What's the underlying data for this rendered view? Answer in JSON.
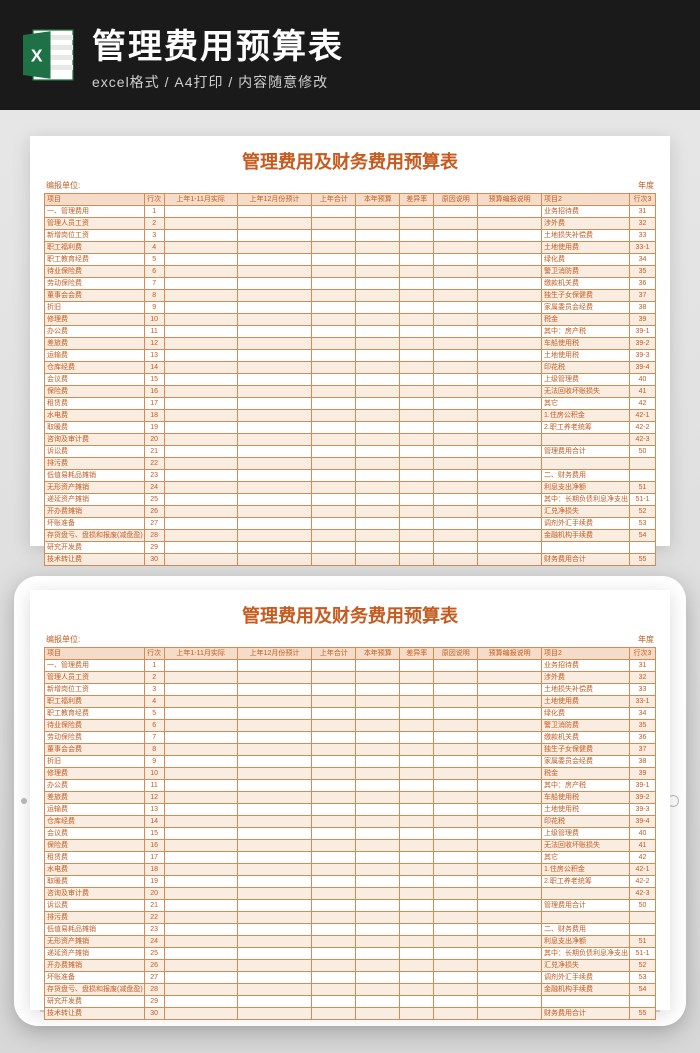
{
  "header": {
    "title": "管理费用预算表",
    "subtitle": "excel格式 / A4打印 / 内容随意修改"
  },
  "sheet": {
    "title": "管理费用及财务费用预算表",
    "unit_label": "编报单位:",
    "year_label": "年度",
    "columns": [
      "项目",
      "行次",
      "上年1-11月实际",
      "上年12月份预计",
      "上年合计",
      "本年预算",
      "差异率",
      "原因说明",
      "预算编报说明",
      "项目2",
      "行次3"
    ],
    "rows": [
      {
        "a": "一、管理费用",
        "n": "1",
        "b": "业务招待费",
        "m": "31"
      },
      {
        "a": "管理人员工资",
        "n": "2",
        "b": "涉外费",
        "m": "32"
      },
      {
        "a": "新增岗位工资",
        "n": "3",
        "b": "土地损失补偿费",
        "m": "33"
      },
      {
        "a": "职工福利费",
        "n": "4",
        "b": "土地使用费",
        "m": "33-1"
      },
      {
        "a": "职工教育经费",
        "n": "5",
        "b": "绿化费",
        "m": "34"
      },
      {
        "a": "待业保险费",
        "n": "6",
        "b": "警卫消防费",
        "m": "35"
      },
      {
        "a": "劳动保险费",
        "n": "7",
        "b": "缴款机关费",
        "m": "36"
      },
      {
        "a": "董事会会费",
        "n": "8",
        "b": "独生子女保健费",
        "m": "37"
      },
      {
        "a": "折旧",
        "n": "9",
        "b": "家属委员会经费",
        "m": "38"
      },
      {
        "a": "修理费",
        "n": "10",
        "b": "税金",
        "m": "39"
      },
      {
        "a": "办公费",
        "n": "11",
        "b": "其中：房产税",
        "m": "39-1"
      },
      {
        "a": "差旅费",
        "n": "12",
        "b": "车船使用税",
        "m": "39-2"
      },
      {
        "a": "运输费",
        "n": "13",
        "b": "土地使用税",
        "m": "39-3"
      },
      {
        "a": "仓库经费",
        "n": "14",
        "b": "印花税",
        "m": "39-4"
      },
      {
        "a": "会议费",
        "n": "15",
        "b": "上级管理费",
        "m": "40"
      },
      {
        "a": "保险费",
        "n": "16",
        "b": "无法回收坏账损失",
        "m": "41"
      },
      {
        "a": "租赁费",
        "n": "17",
        "b": "其它",
        "m": "42"
      },
      {
        "a": "水电费",
        "n": "18",
        "b": "1.住房公积金",
        "m": "42-1"
      },
      {
        "a": "取暖费",
        "n": "19",
        "b": "2.职工养老统筹",
        "m": "42-2"
      },
      {
        "a": "咨询及审计费",
        "n": "20",
        "b": "",
        "m": "42-3"
      },
      {
        "a": "诉讼费",
        "n": "21",
        "b": "管理费用合计",
        "m": "50"
      },
      {
        "a": "排污费",
        "n": "22",
        "b": "",
        "m": ""
      },
      {
        "a": "低值易耗品摊销",
        "n": "23",
        "b": "二、财务费用",
        "m": ""
      },
      {
        "a": "无形资产摊销",
        "n": "24",
        "b": "利息支出净额",
        "m": "51"
      },
      {
        "a": "递延资产摊销",
        "n": "25",
        "b": "其中：长期负债利息净支出",
        "m": "51-1"
      },
      {
        "a": "开办费摊销",
        "n": "26",
        "b": "汇兑净损失",
        "m": "52"
      },
      {
        "a": "坏账准备",
        "n": "27",
        "b": "调剂外汇手续费",
        "m": "53"
      },
      {
        "a": "存货盘亏、盘损和报废(减盘盈)",
        "n": "28",
        "b": "金融机构手续费",
        "m": "54"
      },
      {
        "a": "研究开发费",
        "n": "29",
        "b": "",
        "m": ""
      },
      {
        "a": "技术转让费",
        "n": "30",
        "b": "财务费用合计",
        "m": "55"
      }
    ]
  }
}
